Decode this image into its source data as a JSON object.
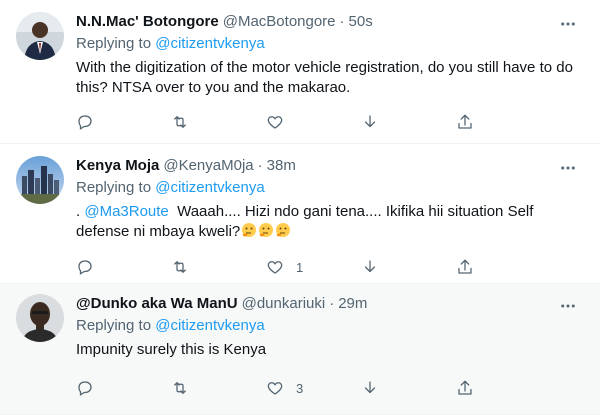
{
  "tweets": [
    {
      "name": "N.N.Mac' Botongore",
      "handle": "@MacBotongore",
      "sep": "·",
      "time": "50s",
      "replying_prefix": "Replying to",
      "replying_to": "@citizentvkenya",
      "text": "With the digitization of the motor vehicle registration, do you still have to do this? NTSA over to you and the makarao.",
      "reply_count": "",
      "retweet_count": "",
      "like_count": ""
    },
    {
      "name": "Kenya Moja",
      "handle": "@KenyaM0ja",
      "sep": "·",
      "time": "38m",
      "replying_prefix": "Replying to",
      "replying_to": "@citizentvkenya",
      "text_pre": ". ",
      "mention": "@Ma3Route",
      "text_post": "  Waaah.... Hizi ndo gani tena.... Ikifika hii situation Self defense ni mbaya kweli?",
      "emojis": [
        "thinking-face",
        "thinking-face",
        "thinking-face"
      ],
      "reply_count": "",
      "retweet_count": "",
      "like_count": "1"
    },
    {
      "name": "@Dunko aka Wa ManU",
      "handle": "@dunkariuki",
      "sep": "·",
      "time": "29m",
      "replying_prefix": "Replying to",
      "replying_to": "@citizentvkenya",
      "text": "Impunity surely this is Kenya",
      "reply_count": "",
      "retweet_count": "",
      "like_count": "3"
    }
  ],
  "colors": {
    "text": "#0f1419",
    "secondary": "#536471",
    "link": "#1d9bf0",
    "divider": "#eff3f4",
    "hover_bg": "#f7f9f9"
  }
}
